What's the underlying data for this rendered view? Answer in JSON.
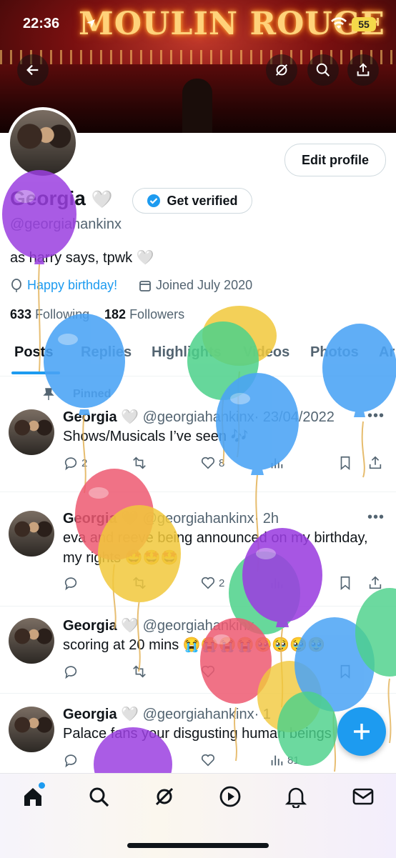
{
  "status_bar": {
    "time": "22:36",
    "battery": "55"
  },
  "banner": {
    "sign_text": "MOULIN ROUGE"
  },
  "profile": {
    "edit_label": "Edit profile",
    "name": "Georgia",
    "heart": "🤍",
    "verified_label": "Get verified",
    "handle": "@georgiahankinx",
    "bio": "as harry says, tpwk 🤍",
    "birthday": "Happy birthday!",
    "joined": "Joined July 2020",
    "following_count": "633",
    "following_label": "Following",
    "followers_count": "182",
    "followers_label": "Followers"
  },
  "tabs": [
    "Posts",
    "Replies",
    "Highlights",
    "Videos",
    "Photos",
    "Ar"
  ],
  "posts": [
    {
      "pinned_label": "Pinned",
      "name": "Georgia",
      "heart": "🤍",
      "handle": "@georgiahankinx",
      "time": "· 23/04/2022",
      "text": "Shows/Musicals I’ve seen 🎶",
      "replies": "2",
      "likes": "8"
    },
    {
      "name": "Georgia",
      "heart": "🤍",
      "handle": "@georgiahankinx",
      "time": "· 2h",
      "text": "eva and reeve being announced on my birthday, my rights 🤩🤩🤩",
      "likes": "2"
    },
    {
      "name": "Georgia",
      "heart": "🤍",
      "handle": "@georgiahankinx",
      "time": "",
      "text": "scoring at 20 mins 😭😭😭😭🥹🥹🥹🥹"
    },
    {
      "name": "Georgia",
      "heart": "🤍",
      "handle": "@georgiahankinx",
      "time": "· 1",
      "text": "Palace fans your disgusting human beings",
      "views": "81"
    }
  ],
  "colors": {
    "accent": "#1d9bf0",
    "text": "#0f1419",
    "muted": "#536471"
  },
  "icons": [
    "back-arrow-icon",
    "grok-icon",
    "search-icon",
    "share-icon",
    "verified-badge-icon",
    "balloon-icon",
    "calendar-icon",
    "pin-icon",
    "reply-icon",
    "repost-icon",
    "like-icon",
    "views-icon",
    "bookmark-icon",
    "home-icon",
    "compose-plus-icon",
    "video-icon",
    "bell-icon",
    "mail-icon"
  ]
}
